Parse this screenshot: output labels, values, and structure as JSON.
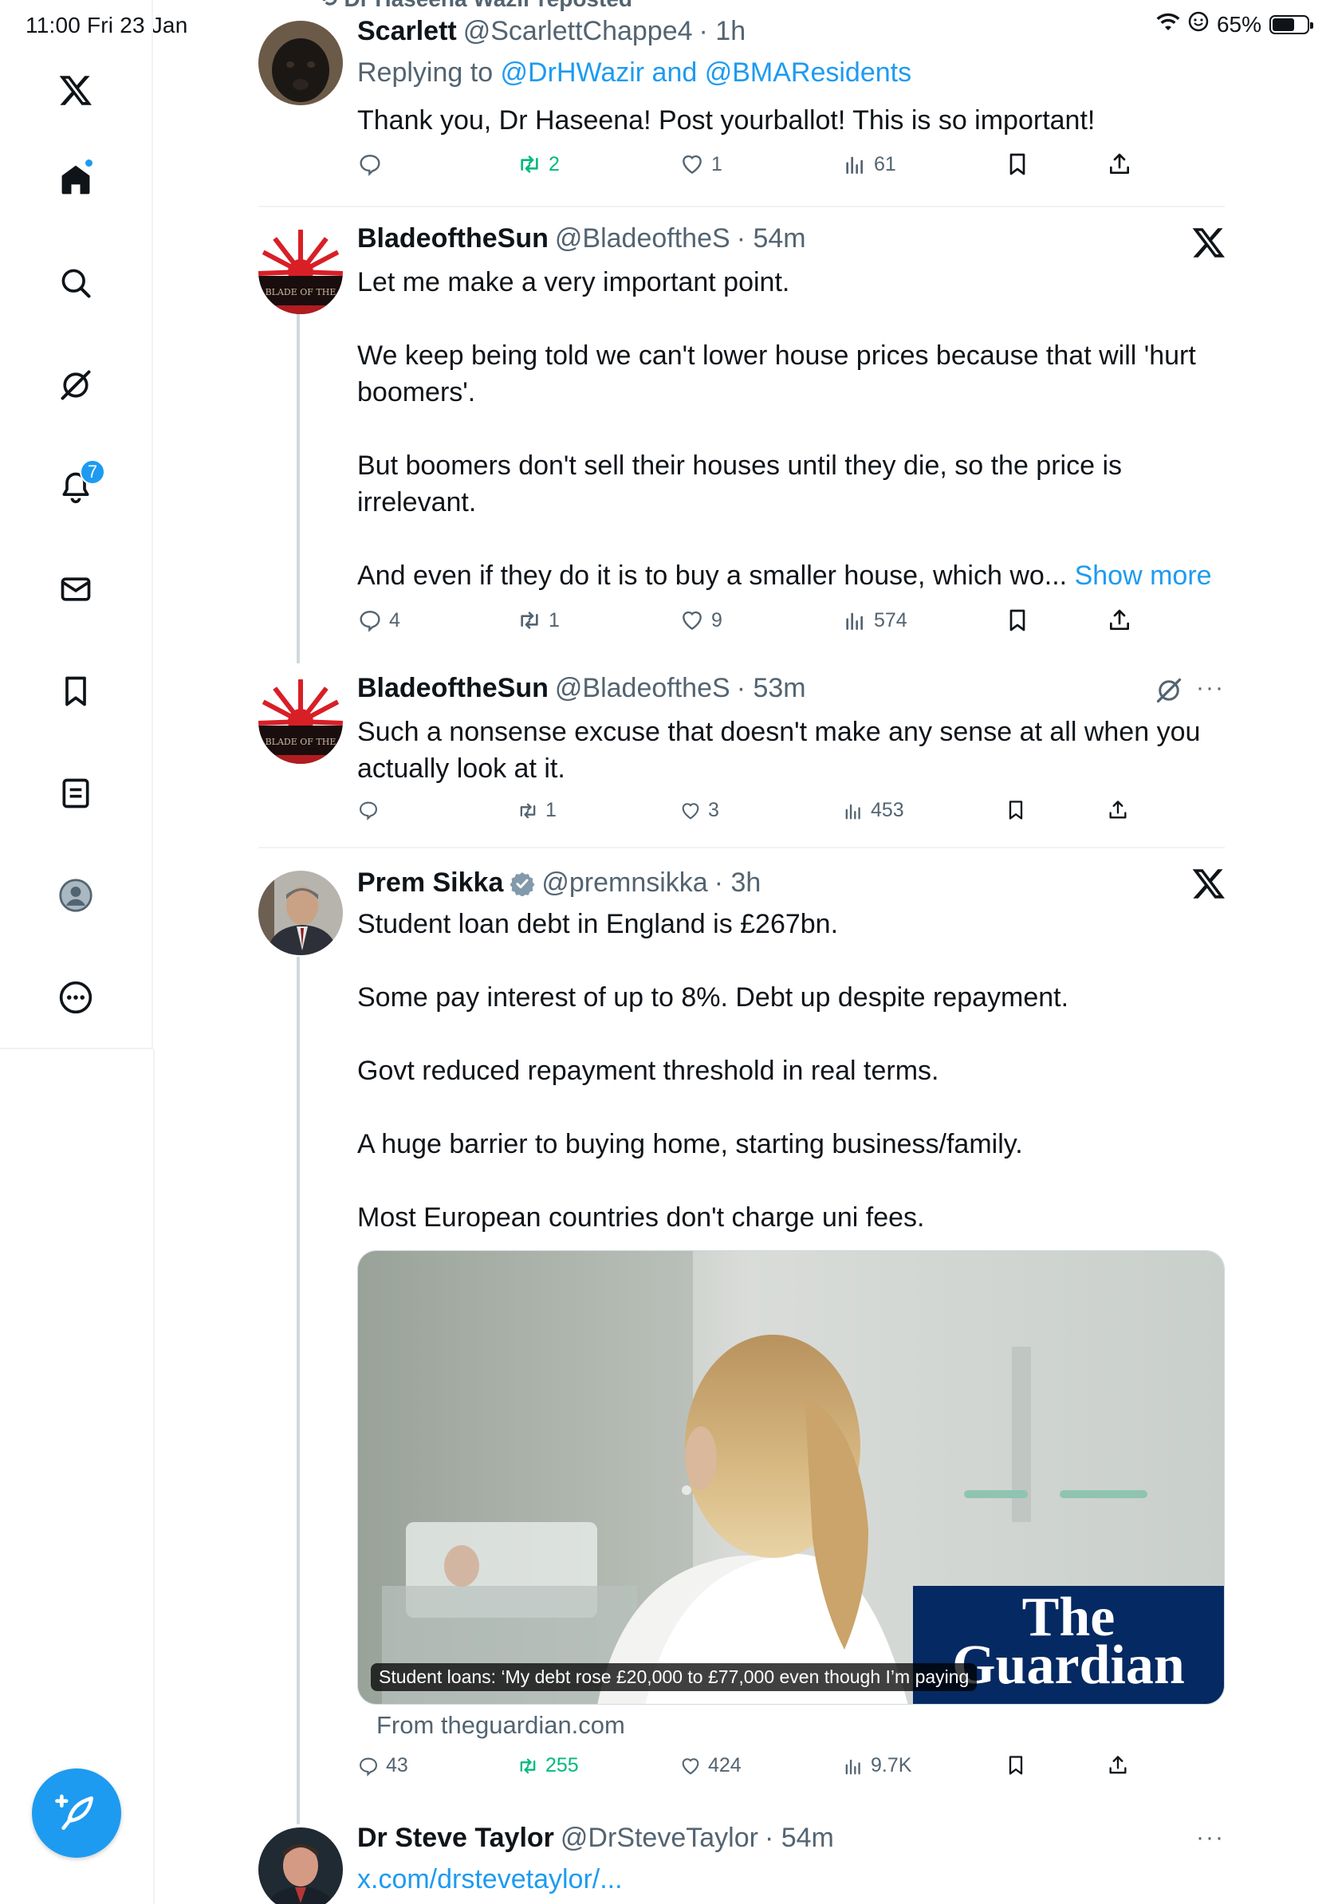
{
  "status_bar": {
    "time": "11:00  Fri 23 Jan",
    "battery": "65%",
    "battery_level": 0.65
  },
  "sidebar": {
    "items": [
      {
        "icon": "x-logo-icon"
      },
      {
        "icon": "home-icon",
        "has_dot": true
      },
      {
        "icon": "search-icon"
      },
      {
        "icon": "grok-icon"
      },
      {
        "icon": "notifications-icon",
        "badge": "7"
      },
      {
        "icon": "messages-icon"
      },
      {
        "icon": "bookmarks-icon"
      },
      {
        "icon": "lists-icon"
      },
      {
        "icon": "profile-icon"
      },
      {
        "icon": "more-icon"
      }
    ],
    "compose_icon": "compose-icon"
  },
  "colors": {
    "accent": "#1d9bf0",
    "retweet": "#00ba7c",
    "muted": "#536471",
    "guardian_blue": "#052962"
  },
  "feed": {
    "reposted_by": "Dr Haseena Wazir reposted",
    "tweets": [
      {
        "name": "Scarlett",
        "handle": "@ScarlettChappe4",
        "time": "· 1h",
        "replying_to_label": "Replying to ",
        "replying_to": "@DrHWazir and @BMAResidents",
        "text": [
          "Thank you, Dr Haseena! Post yourballot! This is so important!"
        ],
        "replies": "",
        "retweets": "2",
        "likes": "1",
        "views": "61"
      },
      {
        "name": "BladeoftheSun",
        "handle": "@BladeoftheS",
        "time": "· 54m",
        "avatar_text": "BLADE OF THE",
        "text": [
          "Let me make a very important point.",
          "We keep being told we can't lower house prices because that will 'hurt boomers'.",
          "But boomers don't sell their houses until they die, so the price is irrelevant."
        ],
        "truncated_text": "And even if they do it is to buy a smaller house, which wo...",
        "show_more": "Show more",
        "replies": "4",
        "retweets": "1",
        "likes": "9",
        "views": "574"
      },
      {
        "name": "BladeoftheSun",
        "handle": "@BladeoftheS",
        "time": "· 53m",
        "text": [
          "Such a nonsense excuse that doesn't make any sense at all when you actually look at it."
        ],
        "replies": "",
        "retweets": "1",
        "likes": "3",
        "views": "453"
      },
      {
        "name": "Prem Sikka",
        "verified": true,
        "handle": "@premnsikka",
        "time": "· 3h",
        "text": [
          "Student loan debt in England is £267bn.",
          "Some pay interest of up to 8%. Debt up despite repayment.",
          "Govt reduced repayment threshold in real terms.",
          "A huge barrier to buying home, starting business/family.",
          "Most European countries don't charge uni fees."
        ],
        "card": {
          "caption": "Student loans: ‘My debt rose £20,000 to £77,000 even though I’m paying",
          "logo_line1": "The",
          "logo_line2": "Guardian",
          "source": "From theguardian.com"
        },
        "replies": "43",
        "retweets": "255",
        "likes": "424",
        "views": "9.7K"
      },
      {
        "name": "Dr Steve Taylor",
        "handle": "@DrSteveTaylor",
        "time": "· 54m",
        "link": "x.com/drstevetaylor/..."
      }
    ]
  }
}
